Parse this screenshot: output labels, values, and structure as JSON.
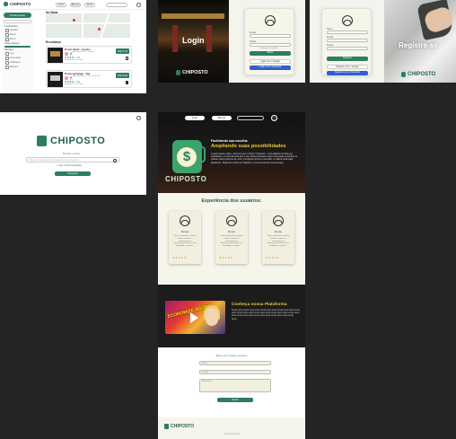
{
  "listing": {
    "brand": "CHIPOSTO",
    "nav": [
      "Início",
      "Buscar",
      "Perfil"
    ],
    "sidebar": {
      "header": "Preferências",
      "filters_label": "Combustível",
      "fuel_options": [
        "Gasolina",
        "Etanol",
        "Diesel"
      ],
      "price_label": "Preço máximo",
      "services_label": "Serviços",
      "service_options": [
        "Loja",
        "Lava-rápido",
        "Calibragem",
        "Banheiro"
      ]
    },
    "map_heading": "No Mapa",
    "results_heading": "Resultados",
    "cards": [
      {
        "name": "Posto Shell - Centro",
        "address": "Av. Brasil, 1200 - Centro",
        "stars": "★★★★☆ 4,2",
        "meta": "Atualizado há 10 min",
        "price": "R$ 5,79"
      },
      {
        "name": "Posto Ipiranga - Sul",
        "address": "Rua das Flores, 300 - Zona Sul",
        "stars": "★★★★☆ 4,0",
        "meta": "Atualizado há 25 min",
        "price": "R$ 5,69"
      }
    ]
  },
  "login": {
    "title": "Login",
    "brand": "CHIPOSTO",
    "email_label": "E-mail",
    "password_label": "Senha",
    "forgot": "Esqueceu a senha?",
    "submit": "Entrar",
    "google": "Logar com o Google",
    "facebook": "Logar com o Facebook"
  },
  "register": {
    "title": "Registre-se",
    "brand": "CHIPOSTO",
    "name_label": "Nome",
    "email_label": "E-mail",
    "password_label": "Senha",
    "submit": "Registrar",
    "google": "Registrar com o Google",
    "facebook": "Registrar com o Facebook"
  },
  "search": {
    "brand": "CHIPOSTO",
    "subtitle": "Buscar postos",
    "placeholder": "Digite um endereço para buscar postos próximos",
    "location": "Usar minha localização",
    "button": "Pesquisar"
  },
  "landing": {
    "nav": [
      "Início",
      "Buscar"
    ],
    "hero_dollar": "$",
    "brand": "CHIPOSTO",
    "hero_kicker": "Facilitando sua escolha",
    "hero_title": "Ampliando suas possibilidades",
    "hero_body": "A partir desse vídeo, dizemos que o Posto \"Chiposto\", uma plataforma feita por estudantes, é a ferramenta que o seu bolso precisava. Aqui você pode encontrar os postos mais próximos de você, comparar preços e escolher o melhor local para abastecer. Seja bem-vindo ao Chiposto, a sua economia começa aqui.",
    "testimonials_title": "Experiência dos usuários:",
    "testimonials": [
      {
        "name": "Nome",
        "text": "\"Nossa plataforma ajudou muitos usuários a economizar no abastecimento diário com facilidade e rapidez.\"",
        "stars": "★★★★★"
      },
      {
        "name": "Nome",
        "text": "\"Nossa plataforma ajudou muitos usuários a economizar no abastecimento diário com facilidade e rapidez.\"",
        "stars": "★★★★★"
      },
      {
        "name": "Nome",
        "text": "\"Nossa plataforma ajudou muitos usuários a economizar no abastecimento diário com facilidade e rapidez.\"",
        "stars": "★★★★★"
      }
    ],
    "video_caption": "ECONOMIZE AGORA",
    "platform_title": "Conheça nossa Plataforma",
    "platform_body": "Texto texto texto texto texto texto texto texto texto texto texto texto texto texto texto texto texto texto texto texto texto texto texto texto texto texto texto texto texto texto texto texto texto texto texto texto.",
    "contact_title": "Entre em contato conosco",
    "contact_fields": [
      "Nome",
      "E-mail",
      "Mensagem"
    ],
    "contact_button": "Enviar",
    "footer_brand": "CHIPOSTO",
    "footer_copy": "©2024 CHIPOSTO"
  }
}
